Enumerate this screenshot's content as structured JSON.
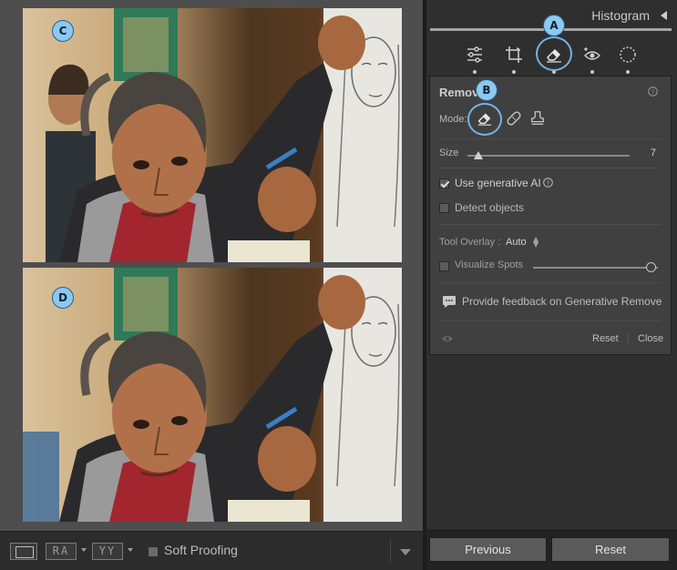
{
  "markers": {
    "a": "A",
    "b": "B",
    "c": "C",
    "d": "D"
  },
  "viewer_toolbar": {
    "compare_left": "RA",
    "compare_right": "YY",
    "soft_proofing_label": "Soft Proofing"
  },
  "panel": {
    "histogram_title": "Histogram",
    "tools": [
      "edit-sliders-icon",
      "crop-icon",
      "remove-eraser-icon",
      "red-eye-icon",
      "masking-icon"
    ],
    "remove": {
      "title": "Remove",
      "mode_label": "Mode:",
      "modes": [
        "remove-eraser-icon",
        "heal-bandage-icon",
        "clone-stamp-icon"
      ],
      "size_label": "Size",
      "size_value": "7",
      "use_generative_ai_label": "Use generative AI",
      "use_generative_ai_checked": true,
      "detect_objects_label": "Detect objects",
      "detect_objects_checked": false,
      "tool_overlay_label": "Tool Overlay :",
      "tool_overlay_value": "Auto",
      "visualize_spots_label": "Visualize Spots",
      "feedback_label": "Provide feedback on Generative Remove",
      "reset_label": "Reset",
      "close_label": "Close"
    },
    "bottom": {
      "previous_label": "Previous",
      "reset_label": "Reset"
    }
  },
  "colors": {
    "accent_ring": "#73b4e6",
    "marker_fill": "#8cc8f0"
  }
}
